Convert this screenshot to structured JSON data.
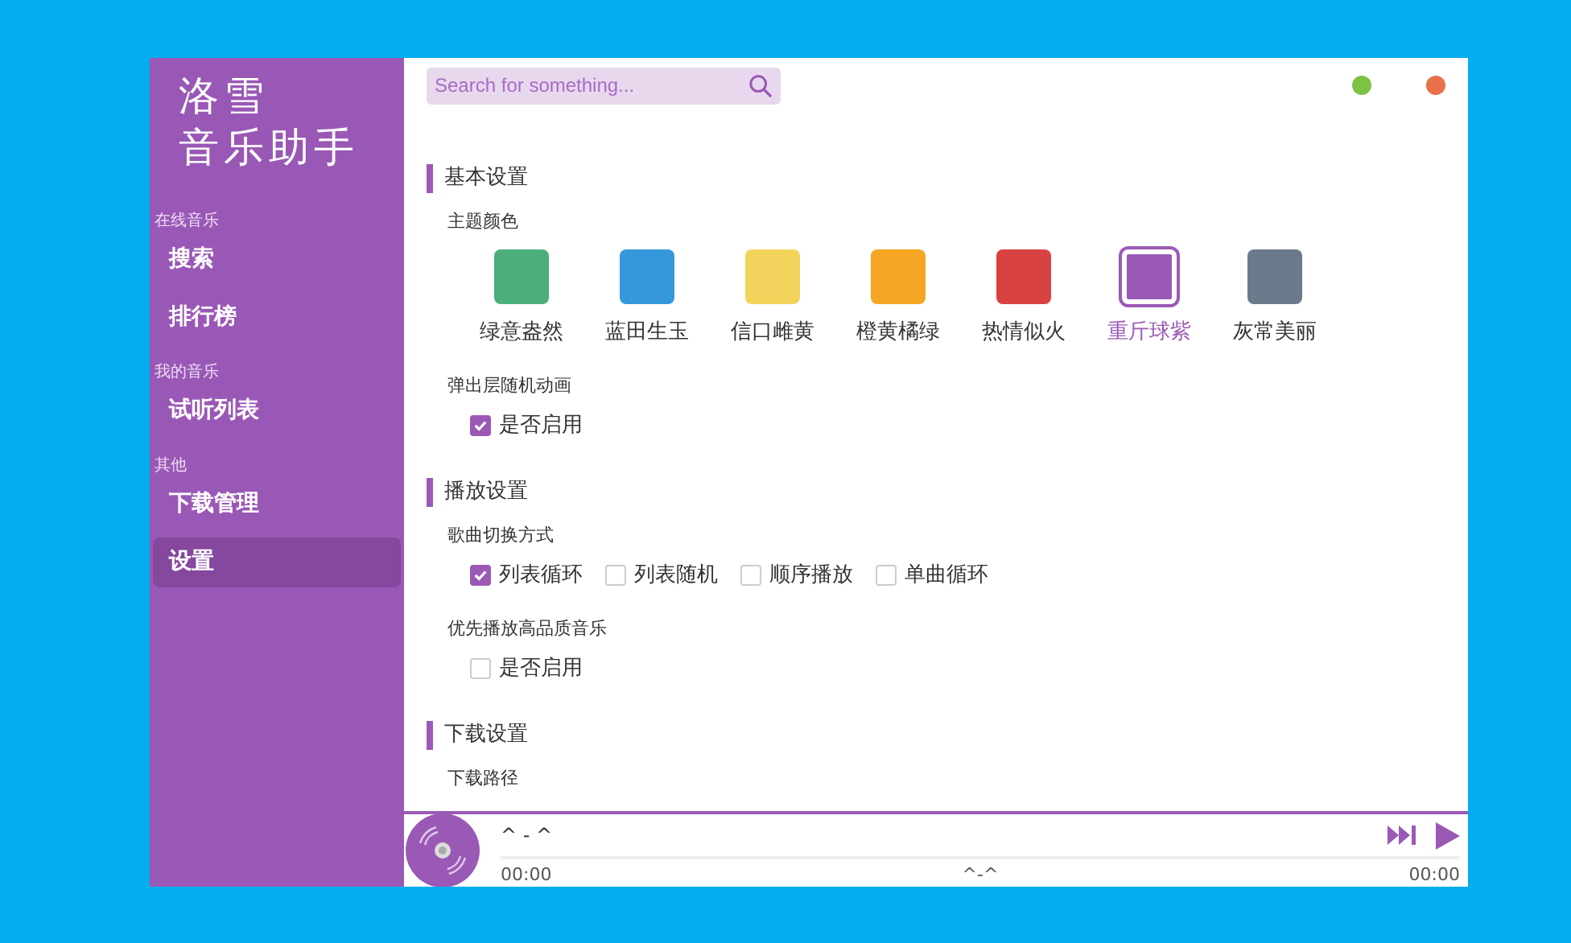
{
  "sidebar": {
    "logo": [
      "洛雪",
      "音乐助手"
    ],
    "groups": [
      {
        "label": "在线音乐",
        "items": [
          {
            "label": "搜索",
            "selected": false
          },
          {
            "label": "排行榜",
            "selected": false
          }
        ]
      },
      {
        "label": "我的音乐",
        "items": [
          {
            "label": "试听列表",
            "selected": false
          }
        ]
      },
      {
        "label": "其他",
        "items": [
          {
            "label": "下载管理",
            "selected": false
          },
          {
            "label": "设置",
            "selected": true
          }
        ]
      }
    ]
  },
  "search": {
    "placeholder": "Search for something..."
  },
  "sections": [
    {
      "title": "基本设置",
      "groups": [
        {
          "label": "主题颜色",
          "kind": "swatches",
          "options": [
            {
              "label": "绿意盎然",
              "color": "#4caf7a",
              "selected": false
            },
            {
              "label": "蓝田生玉",
              "color": "#3498db",
              "selected": false
            },
            {
              "label": "信口雌黄",
              "color": "#f2d45c",
              "selected": false
            },
            {
              "label": "橙黄橘绿",
              "color": "#f5a623",
              "selected": false
            },
            {
              "label": "热情似火",
              "color": "#d94242",
              "selected": false
            },
            {
              "label": "重斤球紫",
              "color": "#9b59b6",
              "selected": true
            },
            {
              "label": "灰常美丽",
              "color": "#6b7a8a",
              "selected": false
            }
          ]
        },
        {
          "label": "弹出层随机动画",
          "kind": "checkboxes",
          "options": [
            {
              "label": "是否启用",
              "checked": true
            }
          ]
        }
      ]
    },
    {
      "title": "播放设置",
      "groups": [
        {
          "label": "歌曲切换方式",
          "kind": "checkboxes",
          "options": [
            {
              "label": "列表循环",
              "checked": true
            },
            {
              "label": "列表随机",
              "checked": false
            },
            {
              "label": "顺序播放",
              "checked": false
            },
            {
              "label": "单曲循环",
              "checked": false
            }
          ]
        },
        {
          "label": "优先播放高品质音乐",
          "kind": "checkboxes",
          "options": [
            {
              "label": "是否启用",
              "checked": false
            }
          ]
        }
      ]
    },
    {
      "title": "下载设置",
      "groups": [
        {
          "label": "下载路径",
          "kind": "label"
        }
      ]
    }
  ],
  "player": {
    "title": "^ - ^",
    "time_current": "00:00",
    "status": "^-^",
    "time_total": "00:00"
  }
}
